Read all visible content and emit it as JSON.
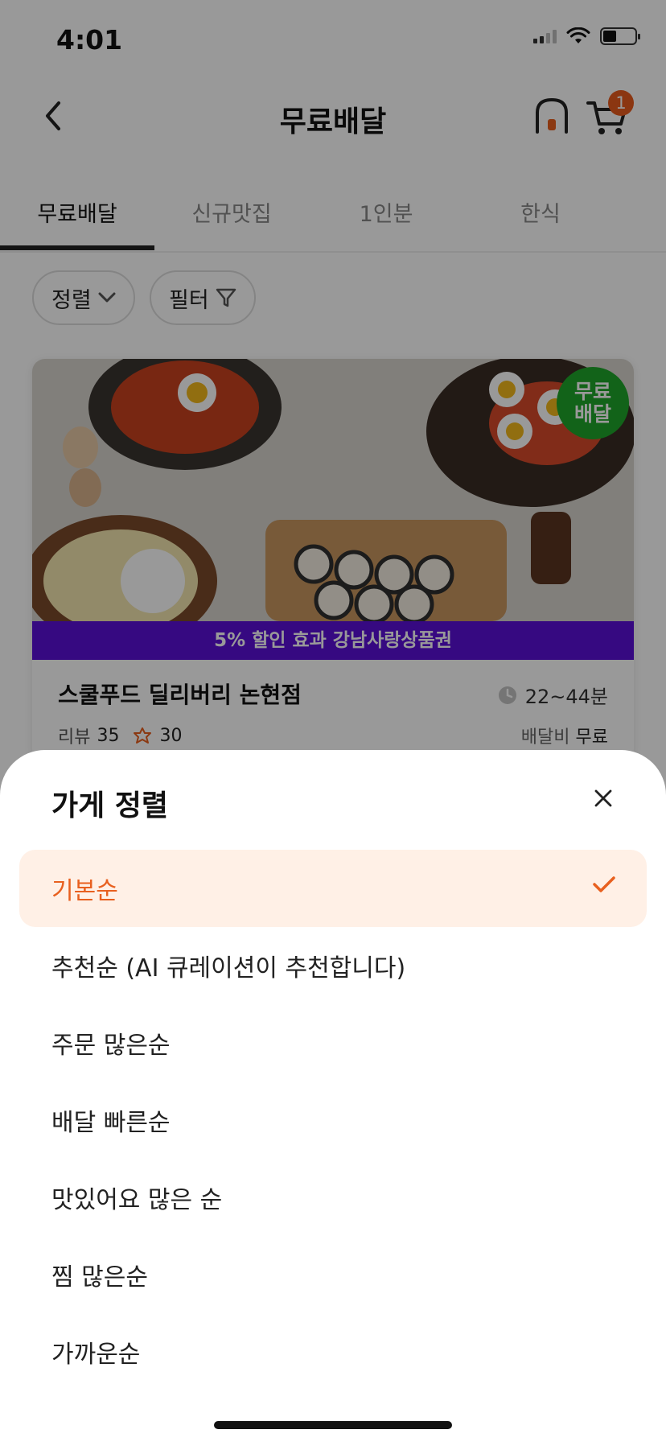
{
  "status": {
    "time": "4:01"
  },
  "header": {
    "title": "무료배달",
    "cart_count": "1"
  },
  "tabs": [
    {
      "label": "무료배달",
      "active": true
    },
    {
      "label": "신규맛집",
      "active": false
    },
    {
      "label": "1인분",
      "active": false
    },
    {
      "label": "한식",
      "active": false
    }
  ],
  "chips": {
    "sort": "정렬",
    "filter": "필터"
  },
  "store": {
    "free_badge_line1": "무료",
    "free_badge_line2": "배달",
    "promo": "5% 할인 효과 강남사랑상품권",
    "name": "스쿨푸드 딜리버리 논현점",
    "eta": "22~44분",
    "review_label": "리뷰",
    "review_count": "35",
    "owner_reply_count": "30",
    "fee_label": "배달비",
    "fee_value": "무료"
  },
  "sheet": {
    "title": "가게 정렬",
    "options": [
      {
        "label": "기본순",
        "selected": true
      },
      {
        "label": "추천순 (AI 큐레이션이 추천합니다)",
        "selected": false
      },
      {
        "label": "주문 많은순",
        "selected": false
      },
      {
        "label": "배달 빠른순",
        "selected": false
      },
      {
        "label": "맛있어요 많은 순",
        "selected": false
      },
      {
        "label": "찜 많은순",
        "selected": false
      },
      {
        "label": "가까운순",
        "selected": false
      }
    ]
  },
  "colors": {
    "accent": "#e8601f",
    "selected_bg": "#fff0e6",
    "promo_bg": "#5a10d8",
    "free_badge": "#1ea52a",
    "cart_badge": "#e85a1d"
  }
}
